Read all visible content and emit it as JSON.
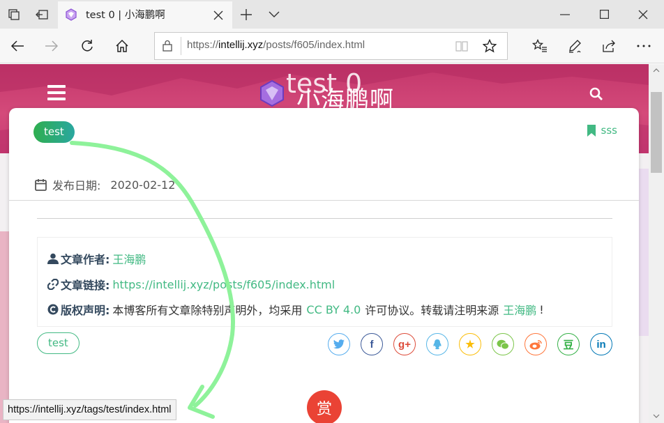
{
  "browser": {
    "tab": {
      "title": "test 0 | 小海鹏啊"
    },
    "url": {
      "scheme": "https://",
      "host": "intellij.xyz",
      "path": "/posts/f605/index.html"
    },
    "status_url": "https://intellij.xyz/tags/test/index.html"
  },
  "hero": {
    "overlay_title": "test 0",
    "site_name": "小海鹏啊"
  },
  "post": {
    "category": "test",
    "bookmark_label": "sss",
    "date_label": "发布日期:",
    "date_value": "2020-02-12",
    "copyright": {
      "author_label": "文章作者:",
      "author_name": "王海鹏",
      "link_label": "文章链接:",
      "link_url": "https://intellij.xyz/posts/f605/index.html",
      "statement_label": "版权声明:",
      "statement_text_1": "本博客所有文章除特别声明外，均采用",
      "license": "CC BY 4.0",
      "statement_text_2": "许可协议。转载请注明来源",
      "source_name": "王海鹏",
      "statement_end": "!"
    },
    "tag": "test",
    "share": [
      {
        "name": "twitter",
        "glyph": "",
        "color": "#55acee"
      },
      {
        "name": "facebook",
        "glyph": "f",
        "color": "#3b5998"
      },
      {
        "name": "google-plus",
        "glyph": "g+",
        "color": "#dd4b39"
      },
      {
        "name": "qq",
        "glyph": "",
        "color": "#56b6e7"
      },
      {
        "name": "qzone",
        "glyph": "★",
        "color": "#fbbd08"
      },
      {
        "name": "wechat",
        "glyph": "",
        "color": "#7bc549"
      },
      {
        "name": "weibo",
        "glyph": "",
        "color": "#ff763b"
      },
      {
        "name": "douban",
        "glyph": "豆",
        "color": "#33b045"
      },
      {
        "name": "linkedin",
        "glyph": "in",
        "color": "#0077b5"
      }
    ],
    "reward_label": "赏"
  },
  "colors": {
    "accent_green": "#42b983",
    "hero_pink": "#c3366b",
    "annotation_green": "#8ef29a"
  }
}
